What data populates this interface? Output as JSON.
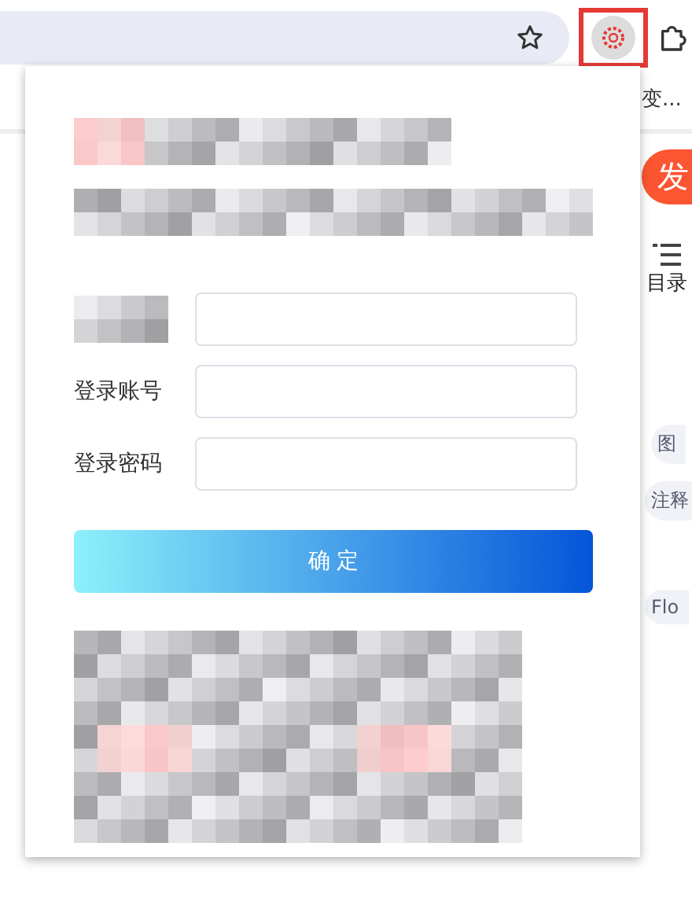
{
  "browser": {
    "extension_highlighted": true,
    "bookmarks": [
      "变..."
    ]
  },
  "page": {
    "publish_button": "发",
    "toc_label": "目录",
    "tags": [
      "图",
      "注释",
      "Flo"
    ]
  },
  "popup": {
    "fields": [
      {
        "kind": "masked"
      },
      {
        "kind": "text",
        "label": "登录账号"
      },
      {
        "kind": "text",
        "label": "登录密码"
      }
    ],
    "submit": "确 定"
  }
}
